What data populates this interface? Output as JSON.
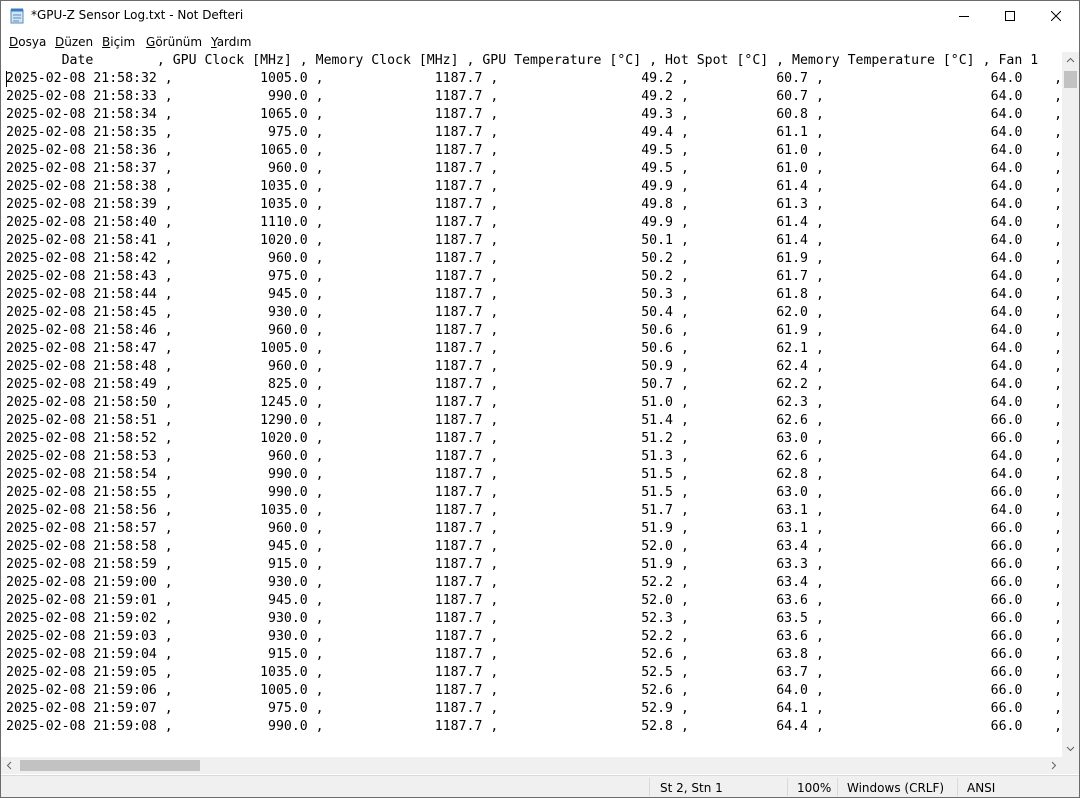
{
  "window": {
    "title": "*GPU-Z Sensor Log.txt - Not Defteri",
    "controls": {
      "minimize": "minimize-icon",
      "maximize": "maximize-icon",
      "close": "close-icon"
    }
  },
  "menu": [
    {
      "first": "D",
      "rest": "osya"
    },
    {
      "first": "D",
      "rest": "üzen"
    },
    {
      "first": "B",
      "rest": "içim"
    },
    {
      "first": "G",
      "rest": "örünüm"
    },
    {
      "first": "Y",
      "rest": "ardım"
    }
  ],
  "document": {
    "header": "       Date        , GPU Clock [MHz] , Memory Clock [MHz] , GPU Temperature [°C] , Hot Spot [°C] , Memory Temperature [°C] , Fan 1",
    "rows": [
      [
        "2025-02-08 21:58:32",
        "1005.0",
        "1187.7",
        "49.2",
        "60.7",
        "64.0"
      ],
      [
        "2025-02-08 21:58:33",
        "990.0",
        "1187.7",
        "49.2",
        "60.7",
        "64.0"
      ],
      [
        "2025-02-08 21:58:34",
        "1065.0",
        "1187.7",
        "49.3",
        "60.8",
        "64.0"
      ],
      [
        "2025-02-08 21:58:35",
        "975.0",
        "1187.7",
        "49.4",
        "61.1",
        "64.0"
      ],
      [
        "2025-02-08 21:58:36",
        "1065.0",
        "1187.7",
        "49.5",
        "61.0",
        "64.0"
      ],
      [
        "2025-02-08 21:58:37",
        "960.0",
        "1187.7",
        "49.5",
        "61.0",
        "64.0"
      ],
      [
        "2025-02-08 21:58:38",
        "1035.0",
        "1187.7",
        "49.9",
        "61.4",
        "64.0"
      ],
      [
        "2025-02-08 21:58:39",
        "1035.0",
        "1187.7",
        "49.8",
        "61.3",
        "64.0"
      ],
      [
        "2025-02-08 21:58:40",
        "1110.0",
        "1187.7",
        "49.9",
        "61.4",
        "64.0"
      ],
      [
        "2025-02-08 21:58:41",
        "1020.0",
        "1187.7",
        "50.1",
        "61.4",
        "64.0"
      ],
      [
        "2025-02-08 21:58:42",
        "960.0",
        "1187.7",
        "50.2",
        "61.9",
        "64.0"
      ],
      [
        "2025-02-08 21:58:43",
        "975.0",
        "1187.7",
        "50.2",
        "61.7",
        "64.0"
      ],
      [
        "2025-02-08 21:58:44",
        "945.0",
        "1187.7",
        "50.3",
        "61.8",
        "64.0"
      ],
      [
        "2025-02-08 21:58:45",
        "930.0",
        "1187.7",
        "50.4",
        "62.0",
        "64.0"
      ],
      [
        "2025-02-08 21:58:46",
        "960.0",
        "1187.7",
        "50.6",
        "61.9",
        "64.0"
      ],
      [
        "2025-02-08 21:58:47",
        "1005.0",
        "1187.7",
        "50.6",
        "62.1",
        "64.0"
      ],
      [
        "2025-02-08 21:58:48",
        "960.0",
        "1187.7",
        "50.9",
        "62.4",
        "64.0"
      ],
      [
        "2025-02-08 21:58:49",
        "825.0",
        "1187.7",
        "50.7",
        "62.2",
        "64.0"
      ],
      [
        "2025-02-08 21:58:50",
        "1245.0",
        "1187.7",
        "51.0",
        "62.3",
        "64.0"
      ],
      [
        "2025-02-08 21:58:51",
        "1290.0",
        "1187.7",
        "51.4",
        "62.6",
        "66.0"
      ],
      [
        "2025-02-08 21:58:52",
        "1020.0",
        "1187.7",
        "51.2",
        "63.0",
        "66.0"
      ],
      [
        "2025-02-08 21:58:53",
        "960.0",
        "1187.7",
        "51.3",
        "62.6",
        "64.0"
      ],
      [
        "2025-02-08 21:58:54",
        "990.0",
        "1187.7",
        "51.5",
        "62.8",
        "64.0"
      ],
      [
        "2025-02-08 21:58:55",
        "990.0",
        "1187.7",
        "51.5",
        "63.0",
        "66.0"
      ],
      [
        "2025-02-08 21:58:56",
        "1035.0",
        "1187.7",
        "51.7",
        "63.1",
        "64.0"
      ],
      [
        "2025-02-08 21:58:57",
        "960.0",
        "1187.7",
        "51.9",
        "63.1",
        "66.0"
      ],
      [
        "2025-02-08 21:58:58",
        "945.0",
        "1187.7",
        "52.0",
        "63.4",
        "66.0"
      ],
      [
        "2025-02-08 21:58:59",
        "915.0",
        "1187.7",
        "51.9",
        "63.3",
        "66.0"
      ],
      [
        "2025-02-08 21:59:00",
        "930.0",
        "1187.7",
        "52.2",
        "63.4",
        "66.0"
      ],
      [
        "2025-02-08 21:59:01",
        "945.0",
        "1187.7",
        "52.0",
        "63.6",
        "66.0"
      ],
      [
        "2025-02-08 21:59:02",
        "930.0",
        "1187.7",
        "52.3",
        "63.5",
        "66.0"
      ],
      [
        "2025-02-08 21:59:03",
        "930.0",
        "1187.7",
        "52.2",
        "63.6",
        "66.0"
      ],
      [
        "2025-02-08 21:59:04",
        "915.0",
        "1187.7",
        "52.6",
        "63.8",
        "66.0"
      ],
      [
        "2025-02-08 21:59:05",
        "1035.0",
        "1187.7",
        "52.5",
        "63.7",
        "66.0"
      ],
      [
        "2025-02-08 21:59:06",
        "1005.0",
        "1187.7",
        "52.6",
        "64.0",
        "66.0"
      ],
      [
        "2025-02-08 21:59:07",
        "975.0",
        "1187.7",
        "52.9",
        "64.1",
        "66.0"
      ],
      [
        "2025-02-08 21:59:08",
        "990.0",
        "1187.7",
        "52.8",
        "64.4",
        "66.0"
      ]
    ]
  },
  "status": {
    "position": "St 2, Stn 1",
    "zoom": "100%",
    "line_ending": "Windows (CRLF)",
    "encoding": "ANSI"
  },
  "scroll": {
    "vertical_position_fraction": 0.0,
    "horizontal_position_fraction": 0.0
  }
}
